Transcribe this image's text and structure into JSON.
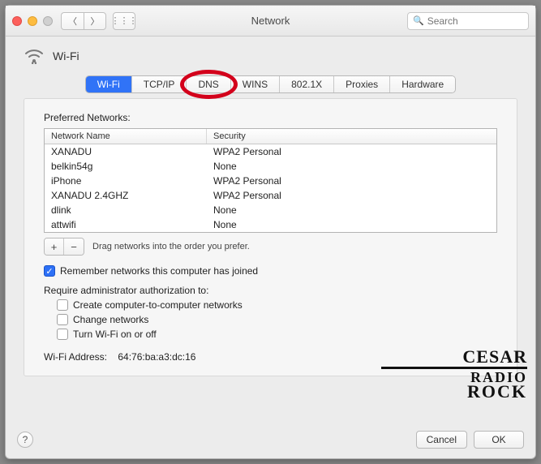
{
  "window": {
    "title": "Network"
  },
  "search": {
    "placeholder": "Search"
  },
  "header": {
    "label": "Wi-Fi"
  },
  "tabs": [
    "Wi-Fi",
    "TCP/IP",
    "DNS",
    "WINS",
    "802.1X",
    "Proxies",
    "Hardware"
  ],
  "active_tab_index": 0,
  "ringed_tab_index": 2,
  "preferred_label": "Preferred Networks:",
  "columns": {
    "name": "Network Name",
    "security": "Security"
  },
  "networks": [
    {
      "name": "XANADU",
      "security": "WPA2 Personal"
    },
    {
      "name": "belkin54g",
      "security": "None"
    },
    {
      "name": "iPhone",
      "security": "WPA2 Personal"
    },
    {
      "name": "XANADU 2.4GHZ",
      "security": "WPA2 Personal"
    },
    {
      "name": "dlink",
      "security": "None"
    },
    {
      "name": "attwifi",
      "security": "None"
    }
  ],
  "drag_hint": "Drag networks into the order you prefer.",
  "remember": {
    "label": "Remember networks this computer has joined",
    "checked": true
  },
  "require_label": "Require administrator authorization to:",
  "require_opts": [
    {
      "label": "Create computer-to-computer networks",
      "checked": false
    },
    {
      "label": "Change networks",
      "checked": false
    },
    {
      "label": "Turn Wi-Fi on or off",
      "checked": false
    }
  ],
  "wifi_addr": {
    "label": "Wi-Fi Address:",
    "value": "64:76:ba:a3:dc:16"
  },
  "buttons": {
    "cancel": "Cancel",
    "ok": "OK"
  },
  "watermark": {
    "l1": "CESAR",
    "l2": "RADIO",
    "l3": "ROCK"
  }
}
